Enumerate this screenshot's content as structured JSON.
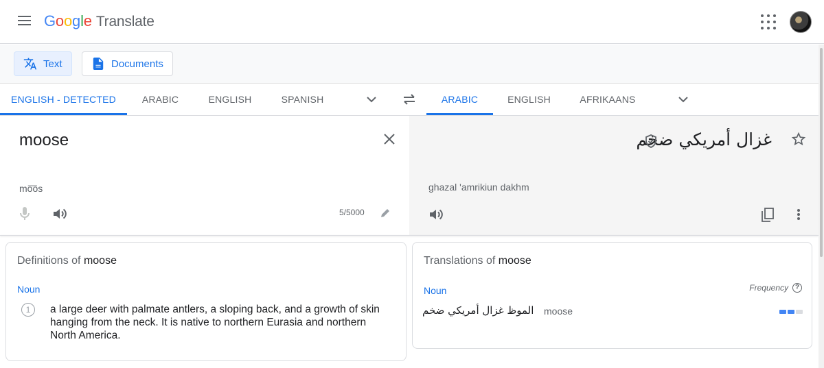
{
  "header": {
    "logo_letters": [
      "G",
      "o",
      "o",
      "g",
      "l",
      "e"
    ],
    "product_name": "Translate"
  },
  "modes": [
    {
      "label": "Text",
      "active": true,
      "icon": "translate-icon"
    },
    {
      "label": "Documents",
      "active": false,
      "icon": "document-icon"
    }
  ],
  "source_langs": [
    {
      "label": "ENGLISH - DETECTED",
      "active": true
    },
    {
      "label": "ARABIC",
      "active": false
    },
    {
      "label": "ENGLISH",
      "active": false
    },
    {
      "label": "SPANISH",
      "active": false
    }
  ],
  "target_langs": [
    {
      "label": "ARABIC",
      "active": true
    },
    {
      "label": "ENGLISH",
      "active": false
    },
    {
      "label": "AFRIKAANS",
      "active": false
    }
  ],
  "source": {
    "text": "moose",
    "pronunciation": "mo͞os",
    "char_count": "5/5000"
  },
  "target": {
    "text": "غزال أمريكي ضخم",
    "transliteration": "ghazal 'amrikiun dakhm"
  },
  "definitions": {
    "title_prefix": "Definitions of",
    "word": "moose",
    "part_of_speech": "Noun",
    "items": [
      {
        "number": "1",
        "text": "a large deer with palmate antlers, a sloping back, and a growth of skin hanging from the neck. It is native to northern Eurasia and northern North America."
      }
    ]
  },
  "translations": {
    "title_prefix": "Translations of",
    "word": "moose",
    "part_of_speech": "Noun",
    "frequency_label": "Frequency",
    "help_glyph": "?",
    "rows": [
      {
        "translation": "الموظ غزال أمريكي ضخم",
        "back_translation": "moose",
        "frequency": 0.67
      }
    ]
  },
  "colors": {
    "accent": "#1a73e8",
    "text_secondary": "#5f6368",
    "target_panel_bg": "#f5f5f5"
  }
}
